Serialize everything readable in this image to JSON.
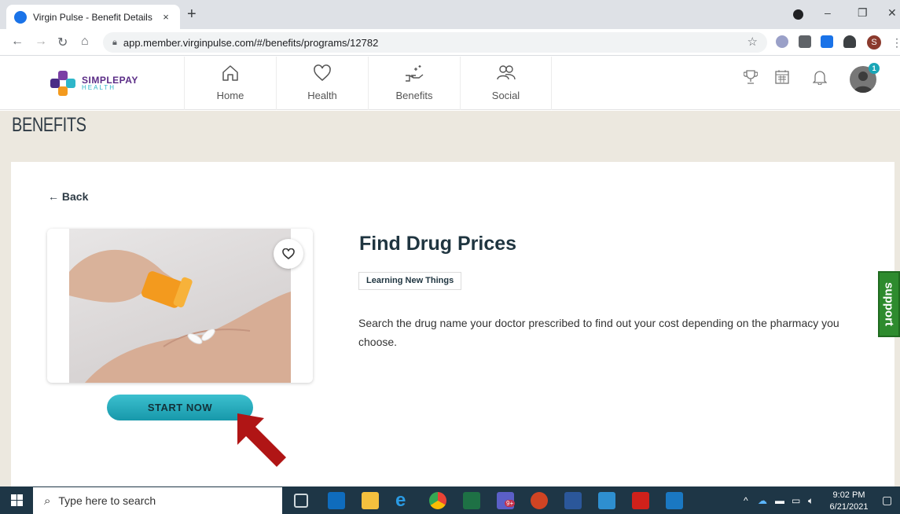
{
  "browser": {
    "tab_title": "Virgin Pulse - Benefit Details",
    "tab_close": "×",
    "new_tab": "+",
    "url": "app.member.virginpulse.com/#/benefits/programs/12782",
    "profile_initial": "S",
    "window_controls": {
      "minimize": "–",
      "restore": "❐",
      "close": "✕"
    }
  },
  "app": {
    "logo_top": "SIMPLEPAY",
    "logo_bottom": "HEALTH",
    "nav": [
      {
        "label": "Home",
        "icon": "home-icon"
      },
      {
        "label": "Health",
        "icon": "heart-icon"
      },
      {
        "label": "Benefits",
        "icon": "benefits-hand-icon"
      },
      {
        "label": "Social",
        "icon": "social-people-icon"
      }
    ],
    "notification_count": "1"
  },
  "page": {
    "title": "BENEFITS",
    "back_label": "Back",
    "program": {
      "heading": "Find Drug Prices",
      "tag": "Learning New Things",
      "description": "Search the drug name your doctor prescribed to find out your cost depending on the pharmacy you choose.",
      "cta": "START NOW"
    },
    "support_label": "support"
  },
  "taskbar": {
    "search_placeholder": "Type here to search",
    "time": "9:02 PM",
    "date": "6/21/2021",
    "teams_badge": "9+"
  },
  "colors": {
    "accent": "#1798aa",
    "page_bg": "#ece8df",
    "support_green": "#2e8b2e",
    "arrow_red": "#b01515",
    "taskbar": "#1e3646"
  }
}
